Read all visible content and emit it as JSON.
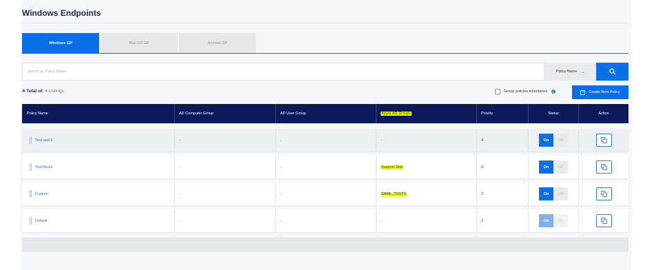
{
  "page": {
    "title": "Windows Endpoints"
  },
  "tabs": [
    {
      "label": "Windows GP",
      "active": true
    },
    {
      "label": "Mac OS GP",
      "active": false
    },
    {
      "label": "Android GP",
      "active": false
    }
  ],
  "search": {
    "placeholder": "Search by Policy Name",
    "value": "",
    "filter_label": "Policy Name",
    "button_icon": "search-icon"
  },
  "summary": {
    "prefix": "A Total of:",
    "count_text": "4 Listings"
  },
  "inheritance": {
    "label": "Group policies inheritance",
    "checked": false,
    "info_icon": "info-icon"
  },
  "create_button": {
    "label": "Create New Policy",
    "icon": "plus-square-icon"
  },
  "table": {
    "columns": [
      "Policy Name",
      "AD Computer Group",
      "AD User Group",
      "Azure AD Groups",
      "Priority",
      "Status",
      "Action"
    ],
    "rows": [
      {
        "name": "Test aad 2",
        "ad_computer_group": "-",
        "ad_user_group": "-",
        "azure_ad_groups": "-",
        "azure_highlight": false,
        "priority": "4",
        "on_label": "On",
        "off_label": "Off",
        "enabled": true
      },
      {
        "name": "Test Azure",
        "ad_computer_group": "-",
        "ad_user_group": "-",
        "azure_ad_groups": "Support Test",
        "azure_highlight": true,
        "priority": "3",
        "on_label": "On",
        "off_label": "Off",
        "enabled": true
      },
      {
        "name": "Custom",
        "ad_computer_group": "-",
        "ad_user_group": "-",
        "azure_ad_groups": "SAML_TESTS",
        "azure_highlight": true,
        "priority": "2",
        "on_label": "On",
        "off_label": "Off",
        "enabled": true
      },
      {
        "name": "Default",
        "ad_computer_group": "-",
        "ad_user_group": "-",
        "azure_ad_groups": "-",
        "azure_highlight": false,
        "priority": "1",
        "on_label": "On",
        "off_label": "Off",
        "enabled": false
      }
    ]
  },
  "colors": {
    "primary": "#0a6fe8",
    "header_bg": "#0c1a5c",
    "highlight": "#f2ff00"
  }
}
